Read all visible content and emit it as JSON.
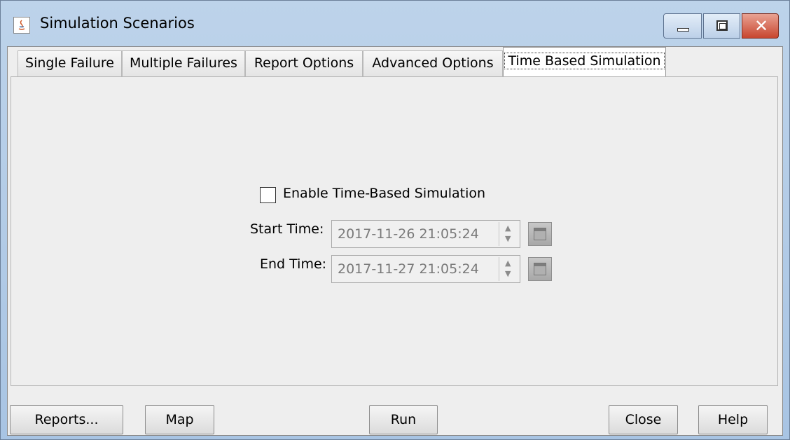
{
  "window": {
    "title": "Simulation Scenarios",
    "close_glyph": "✕"
  },
  "tabs": [
    {
      "label": "Single Failure",
      "active": false
    },
    {
      "label": "Multiple Failures",
      "active": false
    },
    {
      "label": "Report Options",
      "active": false
    },
    {
      "label": "Advanced Options",
      "active": false
    },
    {
      "label": "Time Based Simulation",
      "active": true
    }
  ],
  "time_based": {
    "enable_label": "Enable Time-Based Simulation",
    "enable_checked": false,
    "start_label": "Start Time:",
    "start_value": "2017-11-26 21:05:24",
    "end_label": "End Time:",
    "end_value": "2017-11-27 21:05:24",
    "up_arrow": "▲",
    "down_arrow": "▼"
  },
  "buttons": {
    "reports": "Reports...",
    "map": "Map",
    "run": "Run",
    "close": "Close",
    "help": "Help"
  },
  "colors": {
    "titlebar": "#a8c4e3",
    "close_button": "#c8462f",
    "panel_bg": "#eeeeee"
  }
}
